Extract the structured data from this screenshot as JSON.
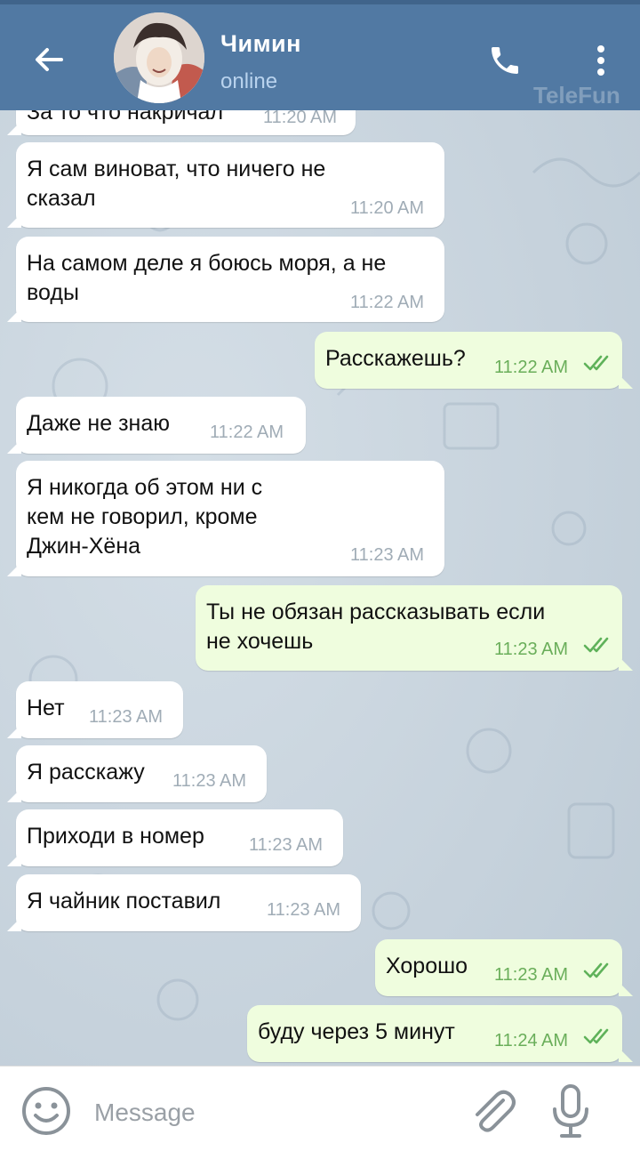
{
  "header": {
    "contact_name": "Чимин",
    "status": "online",
    "watermark": "TeleFun"
  },
  "colors": {
    "header_bg": "#5179a3",
    "incoming_bubble": "#ffffff",
    "outgoing_bubble": "#effdde",
    "read_checks": "#5fb25a"
  },
  "icons": {
    "back": "arrow-left-icon",
    "call": "phone-icon",
    "menu": "more-vertical-icon",
    "emoji": "smile-icon",
    "attach": "paperclip-icon",
    "mic": "microphone-icon"
  },
  "messages": [
    {
      "dir": "in",
      "lines": [
        "За то что накричал"
      ],
      "time": "11:20 AM"
    },
    {
      "dir": "in",
      "lines": [
        "Я сам виноват, что ничего не",
        "сказал"
      ],
      "time": "11:20 AM"
    },
    {
      "dir": "in",
      "lines": [
        "На самом деле я боюсь моря, а не",
        "воды"
      ],
      "time": "11:22 AM"
    },
    {
      "dir": "out",
      "lines": [
        "Расскажешь?"
      ],
      "time": "11:22 AM",
      "read": true
    },
    {
      "dir": "in",
      "lines": [
        "Даже не знаю"
      ],
      "time": "11:22 AM"
    },
    {
      "dir": "in",
      "lines": [
        "Я никогда об этом ни с",
        "кем не говорил, кроме",
        "Джин-Хёна"
      ],
      "time": "11:23 AM"
    },
    {
      "dir": "out",
      "lines": [
        "Ты не обязан рассказывать если",
        "не хочешь"
      ],
      "time": "11:23 AM",
      "read": true
    },
    {
      "dir": "in",
      "lines": [
        "Нет"
      ],
      "time": "11:23 AM"
    },
    {
      "dir": "in",
      "lines": [
        "Я расскажу"
      ],
      "time": "11:23 AM"
    },
    {
      "dir": "in",
      "lines": [
        "Приходи в номер"
      ],
      "time": "11:23 AM"
    },
    {
      "dir": "in",
      "lines": [
        "Я чайник поставил"
      ],
      "time": "11:23 AM"
    },
    {
      "dir": "out",
      "lines": [
        "Хорошо"
      ],
      "time": "11:23 AM",
      "read": true
    },
    {
      "dir": "out",
      "lines": [
        "буду через 5 минут"
      ],
      "time": "11:24 AM",
      "read": true
    }
  ],
  "composer": {
    "placeholder": "Message"
  }
}
